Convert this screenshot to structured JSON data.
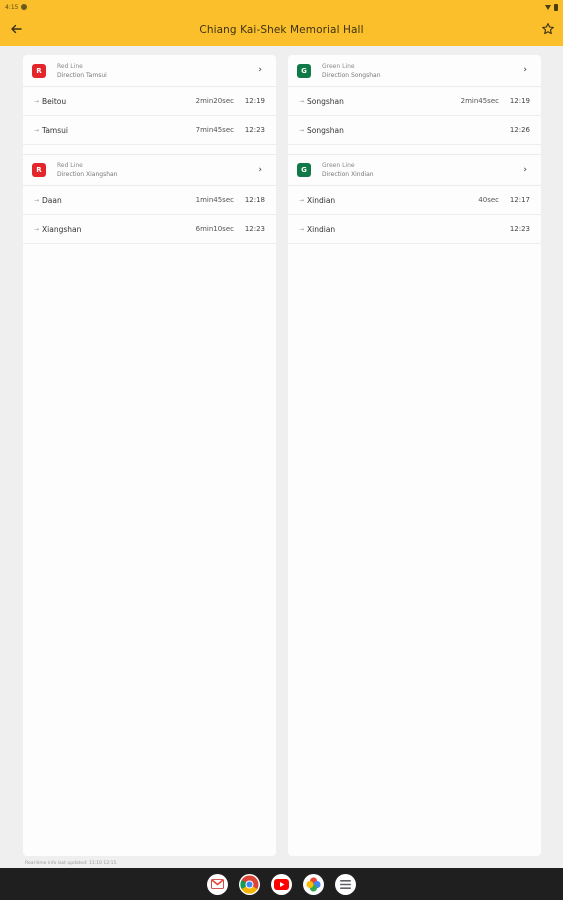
{
  "status": {
    "time": "4:15"
  },
  "header": {
    "title": "Chiang Kai-Shek Memorial Hall"
  },
  "colors": {
    "accent": "#fbbf2c",
    "red_line": "#e3262c",
    "green_line": "#0f7a48"
  },
  "left_panel": {
    "sections": [
      {
        "badge": "R",
        "line": "Red Line",
        "direction": "Direction Tamsui",
        "rows": [
          {
            "dest": "Beitou",
            "eta": "2min20sec",
            "time": "12:19"
          },
          {
            "dest": "Tamsui",
            "eta": "7min45sec",
            "time": "12:23"
          }
        ]
      },
      {
        "badge": "R",
        "line": "Red Line",
        "direction": "Direction Xiangshan",
        "rows": [
          {
            "dest": "Daan",
            "eta": "1min45sec",
            "time": "12:18"
          },
          {
            "dest": "Xiangshan",
            "eta": "6min10sec",
            "time": "12:23"
          }
        ]
      }
    ]
  },
  "right_panel": {
    "sections": [
      {
        "badge": "G",
        "line": "Green Line",
        "direction": "Direction Songshan",
        "rows": [
          {
            "dest": "Songshan",
            "eta": "2min45sec",
            "time": "12:19"
          },
          {
            "dest": "Songshan",
            "eta": "",
            "time": "12:26"
          }
        ]
      },
      {
        "badge": "G",
        "line": "Green Line",
        "direction": "Direction Xindian",
        "rows": [
          {
            "dest": "Xindian",
            "eta": "40sec",
            "time": "12:17"
          },
          {
            "dest": "Xindian",
            "eta": "",
            "time": "12:23"
          }
        ]
      }
    ]
  },
  "footer": {
    "note": "Real-time info last updated: 11:10 12:15"
  },
  "dock": {
    "apps": [
      "gmail-icon",
      "chrome-icon",
      "youtube-icon",
      "photos-icon",
      "app-drawer-icon"
    ]
  }
}
